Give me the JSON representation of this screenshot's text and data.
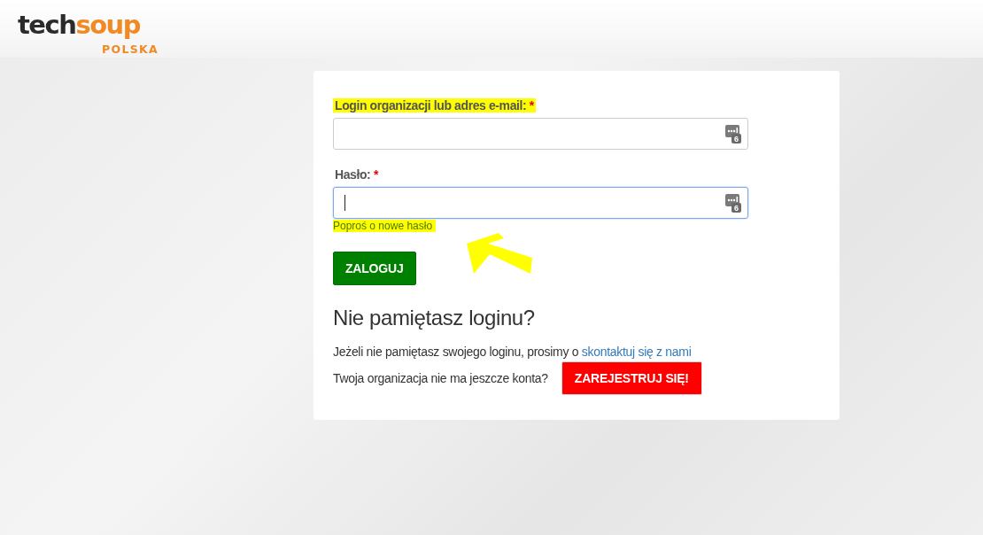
{
  "logo": {
    "word_dark": "tech",
    "word_accent": "soup",
    "subtitle": "POLSKA"
  },
  "form": {
    "fields": [
      {
        "label": "Login organizacji lub adres e-mail:",
        "required_mark": "*",
        "highlighted": true,
        "focused": false,
        "manager_badge": "6"
      },
      {
        "label": "Hasło:",
        "required_mark": "*",
        "highlighted": false,
        "focused": true,
        "manager_badge": "6"
      }
    ],
    "forgot_password_link": {
      "text": "Poproś o nowe hasło",
      "highlighted": true
    },
    "submit_button": "ZALOGUJ"
  },
  "forgot_login": {
    "heading": "Nie pamiętasz loginu?",
    "text": "Jeżeli nie pamiętasz swojego loginu, prosimy o",
    "contact_link": "skontaktuj się z nami",
    "register_prompt": "Twoja organizacja nie ma jeszcze konta?",
    "register_button": "ZAREJESTRUJ SIĘ!"
  }
}
